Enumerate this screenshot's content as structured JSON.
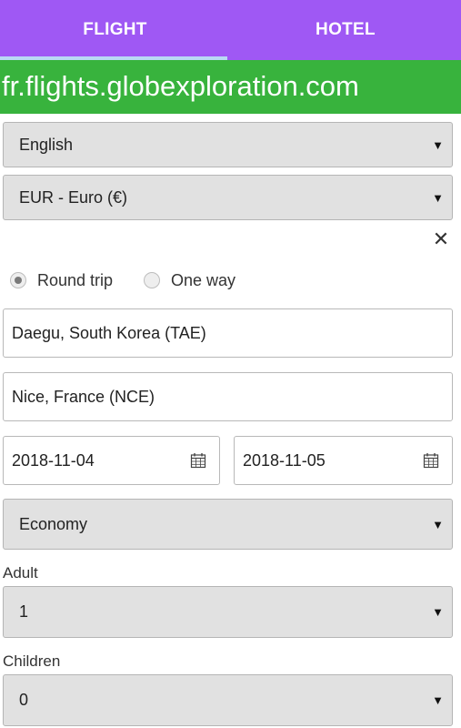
{
  "tabs": {
    "flight": "FLIGHT",
    "hotel": "HOTEL"
  },
  "url": "fr.flights.globexploration.com",
  "language_select": {
    "value": "English"
  },
  "currency_select": {
    "value": "EUR - Euro (€)"
  },
  "close_glyph": "✕",
  "trip_type": {
    "round_trip": "Round trip",
    "one_way": "One way",
    "selected": "round_trip"
  },
  "origin": {
    "value": "Daegu, South Korea (TAE)"
  },
  "destination": {
    "value": "Nice, France (NCE)"
  },
  "depart_date": {
    "value": "2018-11-04"
  },
  "return_date": {
    "value": "2018-11-05"
  },
  "cabin_select": {
    "value": "Economy"
  },
  "adult": {
    "label": "Adult",
    "value": "1"
  },
  "children": {
    "label": "Children",
    "value": "0"
  },
  "caret_glyph": "▼",
  "icons": {
    "calendar": "calendar-icon",
    "dropdown": "chevron-down-icon",
    "close": "close-icon"
  },
  "colors": {
    "tab_bar": "#9f58f4",
    "url_bar": "#38b33d",
    "tab_indicator": "#b9d9f4"
  }
}
